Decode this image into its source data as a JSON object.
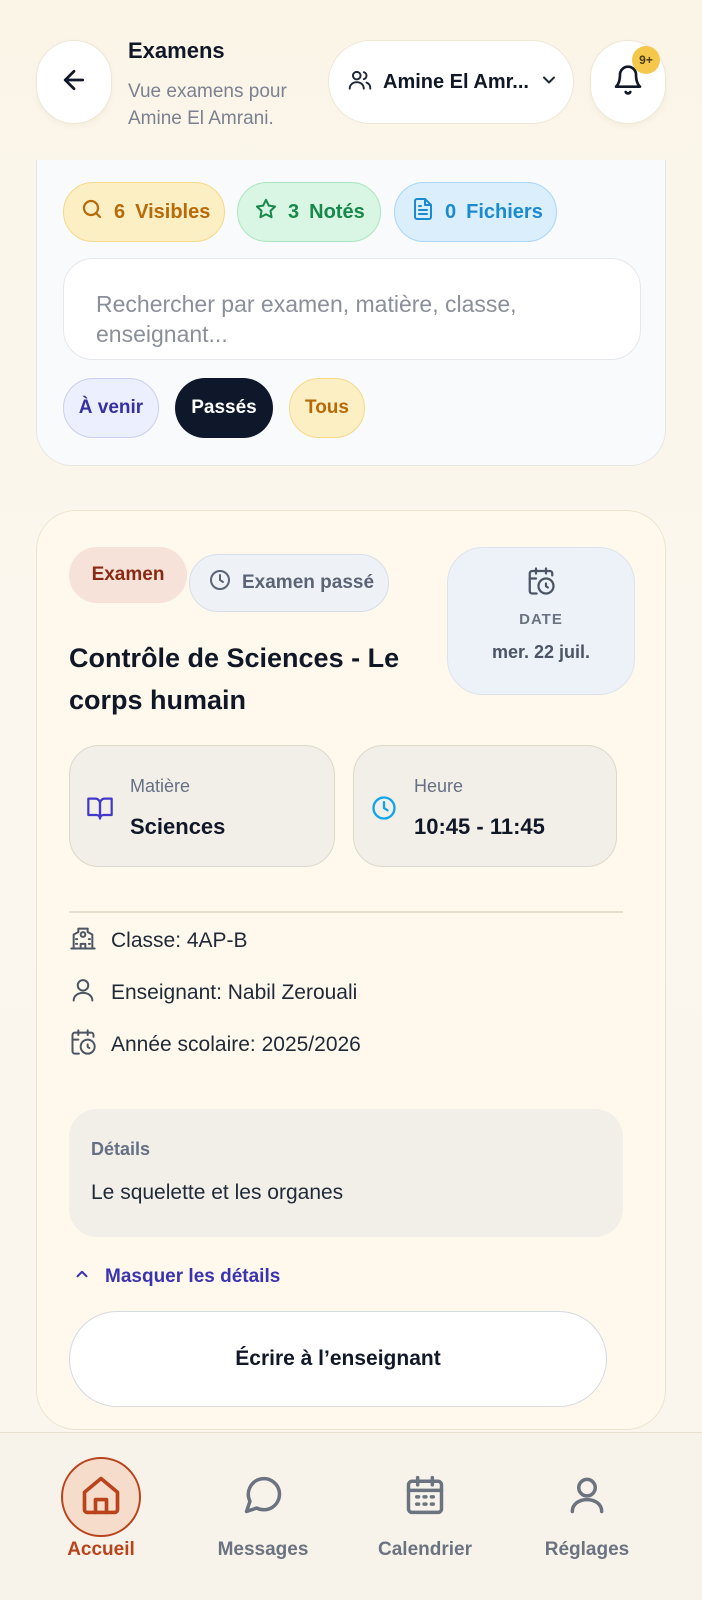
{
  "header": {
    "title": "Examens",
    "subtitle": "Vue examens pour Amine El Amrani.",
    "user_select": "Amine El Amr...",
    "notification_badge": "9+"
  },
  "filters": {
    "stats": {
      "visibles_count": "6",
      "visibles_label": "Visibles",
      "notes_count": "3",
      "notes_label": "Notés",
      "fichiers_count": "0",
      "fichiers_label": "Fichiers"
    },
    "search_placeholder": "Rechercher par examen, matière, classe, enseignant...",
    "segments": {
      "avenir": "À venir",
      "passes": "Passés",
      "tous": "Tous"
    },
    "active_segment": "passes"
  },
  "exam": {
    "type_label": "Examen",
    "status_label": "Examen passé",
    "date_label": "DATE",
    "date_value": "mer. 22 juil.",
    "title": "Contrôle de Sciences - Le corps humain",
    "subject_label": "Matière",
    "subject_value": "Sciences",
    "time_label": "Heure",
    "time_value": "10:45 - 11:45",
    "class_text": "Classe: 4AP-B",
    "teacher_text": "Enseignant: Nabil Zerouali",
    "school_year_text": "Année scolaire: 2025/2026",
    "details_label": "Détails",
    "details_text": "Le squelette et les organes",
    "toggle_details": "Masquer les détails",
    "write_button": "Écrire à l’enseignant"
  },
  "nav": {
    "home": "Accueil",
    "messages": "Messages",
    "calendar": "Calendrier",
    "settings": "Réglages",
    "active": "home"
  },
  "colors": {
    "accent_nav": "#b9441c",
    "active_segment_bg": "#0f172a",
    "link": "#3b34b0"
  }
}
